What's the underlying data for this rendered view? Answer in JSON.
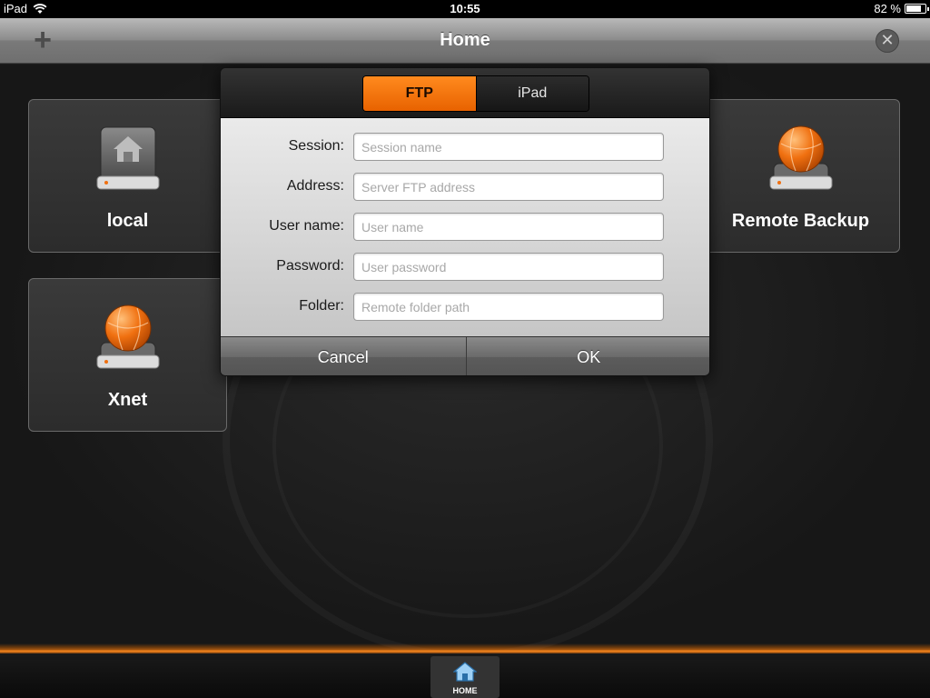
{
  "status_bar": {
    "device": "iPad",
    "time": "10:55",
    "battery": "82 %",
    "battery_level_percent": 82,
    "icons": [
      "wifi-icon",
      "battery-icon"
    ]
  },
  "nav_bar": {
    "title": "Home",
    "add_icon": "plus-icon",
    "close_icon": "close-icon"
  },
  "tiles": [
    {
      "label": "local",
      "icon": "home-drive-icon"
    },
    {
      "label": "Remote Backup",
      "icon": "globe-drive-icon"
    },
    {
      "label": "Xnet",
      "icon": "globe-drive-icon"
    }
  ],
  "dialog": {
    "tabs": [
      {
        "label": "FTP",
        "selected": true
      },
      {
        "label": "iPad",
        "selected": false
      }
    ],
    "fields": [
      {
        "label": "Session:",
        "placeholder": "Session name",
        "value": ""
      },
      {
        "label": "Address:",
        "placeholder": "Server FTP address",
        "value": ""
      },
      {
        "label": "User name:",
        "placeholder": "User name",
        "value": ""
      },
      {
        "label": "Password:",
        "placeholder": "User password",
        "value": ""
      },
      {
        "label": "Folder:",
        "placeholder": "Remote folder path",
        "value": ""
      }
    ],
    "cancel_label": "Cancel",
    "ok_label": "OK"
  },
  "tab_bar": {
    "home_label": "HOME",
    "home_icon": "home-icon"
  },
  "colors": {
    "accent": "#f07010",
    "background": "#1e1e1e",
    "tile_border": "#6a6a6a"
  }
}
